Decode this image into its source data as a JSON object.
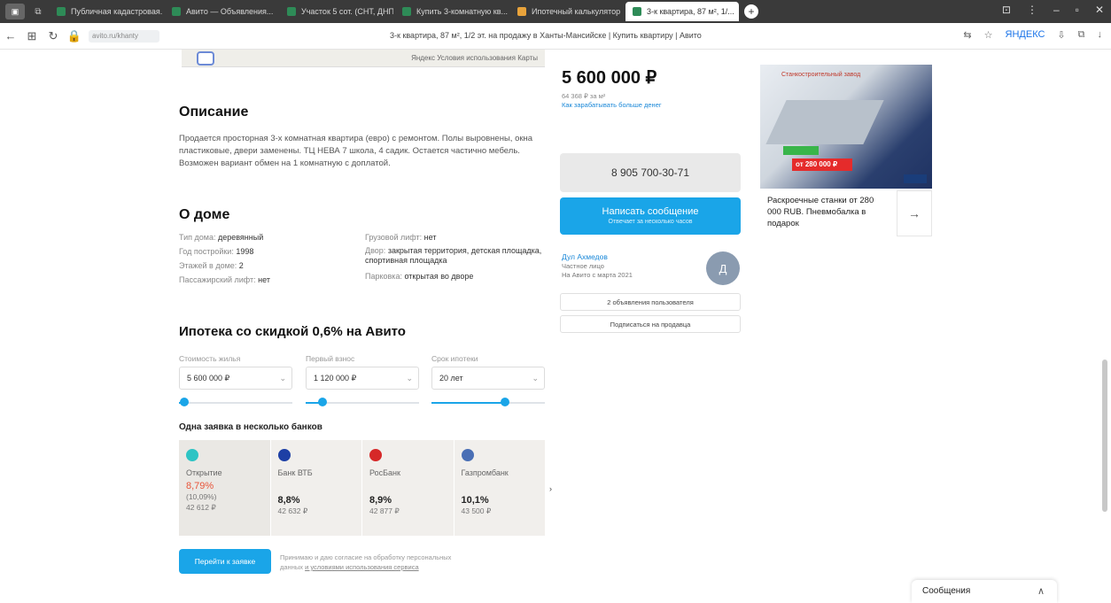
{
  "browser": {
    "tabs": [
      {
        "label": "Публичная кадастровая...",
        "color": "#2e8b57"
      },
      {
        "label": "Авито — Объявления...",
        "color": "#2e8b57"
      },
      {
        "label": "Участок 5 сот. (СНТ, ДНП)",
        "color": "#2e8b57"
      },
      {
        "label": "Купить 3-комнатную кв...",
        "color": "#2e8b57"
      },
      {
        "label": "Ипотечный калькулятор",
        "color": "#e8a33b"
      },
      {
        "label": "3-к квартира, 87 м², 1/...",
        "color": "#2e8b57"
      }
    ],
    "active_tab_index": 5,
    "page_title": "3-к квартира, 87 м², 1/2 эт. на продажу в Ханты-Мансийске | Купить квартиру | Авито",
    "address_chip": "avito.ru/khanty",
    "yandex_label": "ЯНДЕКС"
  },
  "map": {
    "label": "Яндекс Условия использования  Карты"
  },
  "description": {
    "title": "Описание",
    "text": "Продается просторная 3-х комнатная квартира (евро) с ремонтом. Полы выровнены, окна пластиковые, двери заменены. ТЦ НЕВА 7 школа, 4 садик. Остается частично мебель. Возможен вариант обмен на 1 комнатную с доплатой."
  },
  "house": {
    "title": "О доме",
    "left": [
      {
        "k": "Тип дома:",
        "v": "деревянный"
      },
      {
        "k": "Год постройки:",
        "v": "1998"
      },
      {
        "k": "Этажей в доме:",
        "v": "2"
      },
      {
        "k": "Пассажирский лифт:",
        "v": "нет"
      }
    ],
    "right": [
      {
        "k": "Грузовой лифт:",
        "v": "нет"
      },
      {
        "k": "Двор:",
        "v": "закрытая территория, детская площадка, спортивная площадка"
      },
      {
        "k": "Парковка:",
        "v": "открытая во дворе"
      }
    ]
  },
  "mortgage": {
    "title": "Ипотека со скидкой 0,6% на Авито",
    "fields": [
      {
        "label": "Стоимость жилья",
        "value": "5 600 000 ₽",
        "slider": 0.05
      },
      {
        "label": "Первый взнос",
        "value": "1 120 000 ₽",
        "slider": 0.15
      },
      {
        "label": "Срок ипотеки",
        "value": "20 лет",
        "slider": 0.65
      }
    ],
    "banks_title": "Одна заявка в несколько банков",
    "banks": [
      {
        "name": "Открытие",
        "rate": "8,79%",
        "rate_note": "(10,09%)",
        "payment": "42 612 ₽",
        "color": "#2ec4c4",
        "highlight": true
      },
      {
        "name": "Банк ВТБ",
        "rate": "8,8%",
        "rate_note": "",
        "payment": "42 632 ₽",
        "color": "#1d3fa5",
        "highlight": false
      },
      {
        "name": "РосБанк",
        "rate": "8,9%",
        "rate_note": "",
        "payment": "42 877 ₽",
        "color": "#d62828",
        "highlight": false
      },
      {
        "name": "Газпромбанк",
        "rate": "10,1%",
        "rate_note": "",
        "payment": "43 500 ₽",
        "color": "#4a6fb5",
        "highlight": false
      }
    ],
    "next_arrow": "›",
    "send_button": "Перейти к заявке",
    "legal_text": "Принимаю и даю согласие на обработку персональных данных",
    "legal_link": "и условиями использования сервиса"
  },
  "offer": {
    "price": "5 600 000 ₽",
    "price_per_m2": "64 368 ₽ за м²",
    "price_link": "Как зарабатывать больше денег",
    "phone": "8 905 700-30-71",
    "message_button": "Написать сообщение",
    "message_note": "Отвечает за несколько часов",
    "seller_name": "Дул Ахмедов",
    "seller_type": "Частное лицо",
    "seller_since": "На Авито с марта 2021",
    "avatar_letter": "Д",
    "all_ads": "2 объявления пользователя",
    "subscribe": "Подписаться на продавца"
  },
  "ad": {
    "brand": "Станкостроительный завод",
    "price_tag": "от 280 000 ₽",
    "text": "Раскроечные станки от 280 000 RUB. Пневмобалка в подарок",
    "arrow": "→"
  },
  "widget": {
    "messages_label": "Сообщения",
    "chevron": "∧"
  }
}
